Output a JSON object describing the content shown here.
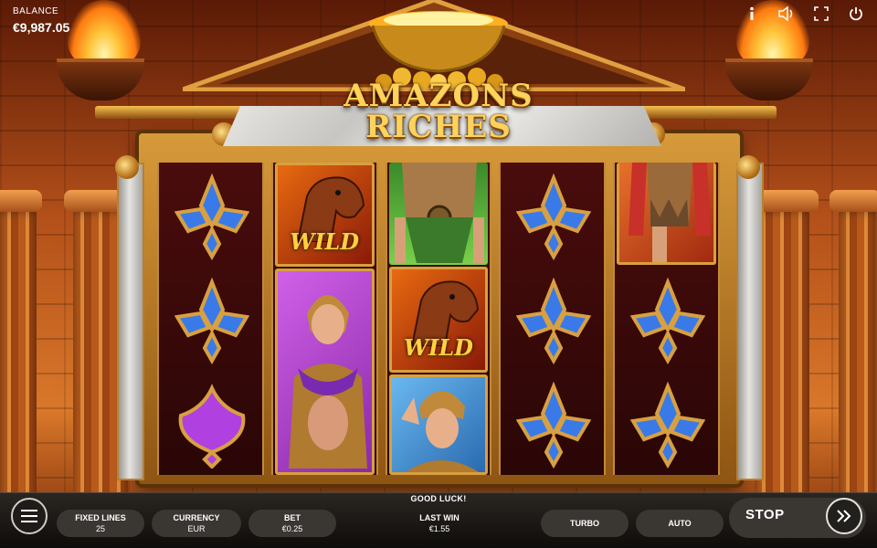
{
  "hud": {
    "balance_label": "BALANCE",
    "balance_value": "€9,987.05"
  },
  "top_icons": [
    "info-icon",
    "sound-icon",
    "fullscreen-icon",
    "power-icon"
  ],
  "logo": {
    "line1": "AMAZONS",
    "line2": "RICHES"
  },
  "reels": [
    [
      "blue-fleur-gem",
      "blue-fleur-gem",
      "purple-heart-gem"
    ],
    [
      "wild-horse",
      "amazon-warrior-purple",
      "amazon-warrior-purple"
    ],
    [
      "warrior-green",
      "wild-horse",
      "amazon-warrior-blue"
    ],
    [
      "blue-fleur-gem",
      "blue-fleur-gem",
      "blue-fleur-gem"
    ],
    [
      "warrior-red",
      "blue-fleur-gem",
      "blue-fleur-gem"
    ]
  ],
  "wild_text": "WILD",
  "bottom": {
    "message": "GOOD LUCK!",
    "fixed_lines_label": "FIXED LINES",
    "fixed_lines_value": "25",
    "currency_label": "CURRENCY",
    "currency_value": "EUR",
    "bet_label": "BET",
    "bet_value": "€0.25",
    "last_win_label": "LAST WIN",
    "last_win_value": "€1.55",
    "turbo_label": "TURBO",
    "auto_label": "AUTO",
    "stop_label": "STOP"
  },
  "colors": {
    "gold": "#ffd25a",
    "reel_bg": "#3a0808",
    "blue_gem": "#3a7ae8",
    "purple_gem": "#b040e0"
  }
}
